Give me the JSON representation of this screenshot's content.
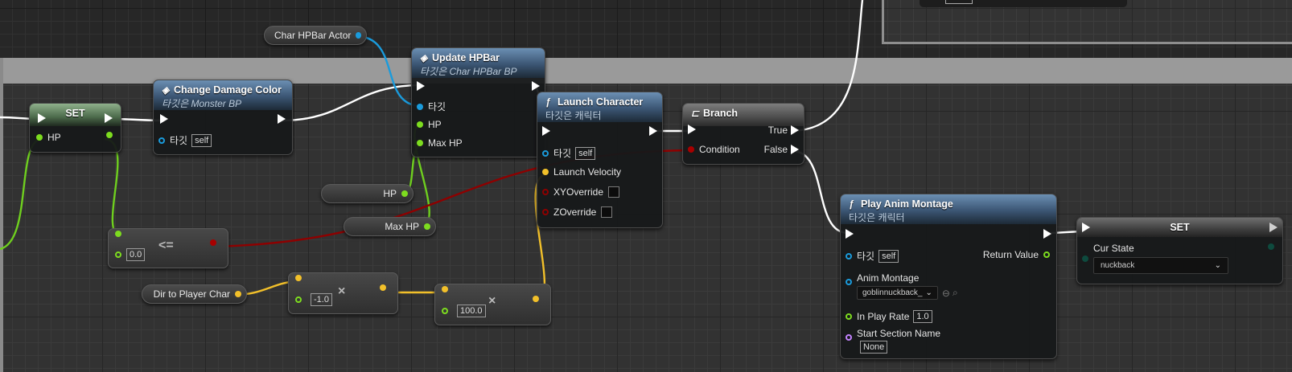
{
  "colors": {
    "exec": "#ffffff",
    "bool": "#8e0000",
    "float": "#7ddc1f",
    "object": "#1a9bdc",
    "vector": "#f2c02a",
    "name": "#c383ff"
  },
  "nodes": {
    "set_hp": {
      "title": "SET",
      "pin": "HP"
    },
    "change_damage_color": {
      "title": "Change Damage Color",
      "subtitle": "타깃은 Monster BP",
      "target_label": "타깃",
      "target_value": "self"
    },
    "char_hpbar_actor": {
      "label": "Char HPBar Actor"
    },
    "update_hpbar": {
      "title": "Update HPBar",
      "subtitle": "타깃은 Char HPBar BP",
      "pins": [
        "타깃",
        "HP",
        "Max HP"
      ]
    },
    "hp_getter": {
      "label": "HP"
    },
    "maxhp_getter": {
      "label": "Max HP"
    },
    "compare": {
      "symbol": "<=",
      "value": "0.0"
    },
    "launch_character": {
      "title": "Launch Character",
      "subtitle": "타깃은 캐릭터",
      "target_label": "타깃",
      "target_value": "self",
      "pins": [
        "Launch Velocity",
        "XYOverride",
        "ZOverride"
      ]
    },
    "branch": {
      "title": "Branch",
      "condition": "Condition",
      "true_label": "True",
      "false_label": "False"
    },
    "dir_to_player": {
      "label": "Dir to Player Char"
    },
    "multiply1": {
      "symbol": "×",
      "value": "-1.0"
    },
    "multiply2": {
      "symbol": "×",
      "value": "100.0"
    },
    "play_anim_montage": {
      "title": "Play Anim Montage",
      "subtitle": "타깃은 캐릭터",
      "target_label": "타깃",
      "target_value": "self",
      "return_label": "Return Value",
      "anim_montage_label": "Anim Montage",
      "anim_montage_value": "goblinnuckback_",
      "play_rate_label": "In Play Rate",
      "play_rate_value": "1.0",
      "start_section_label": "Start Section Name",
      "start_section_value": "None"
    },
    "set_cur_state": {
      "title": "SET",
      "pin": "Cur State",
      "value": "nuckback"
    }
  }
}
